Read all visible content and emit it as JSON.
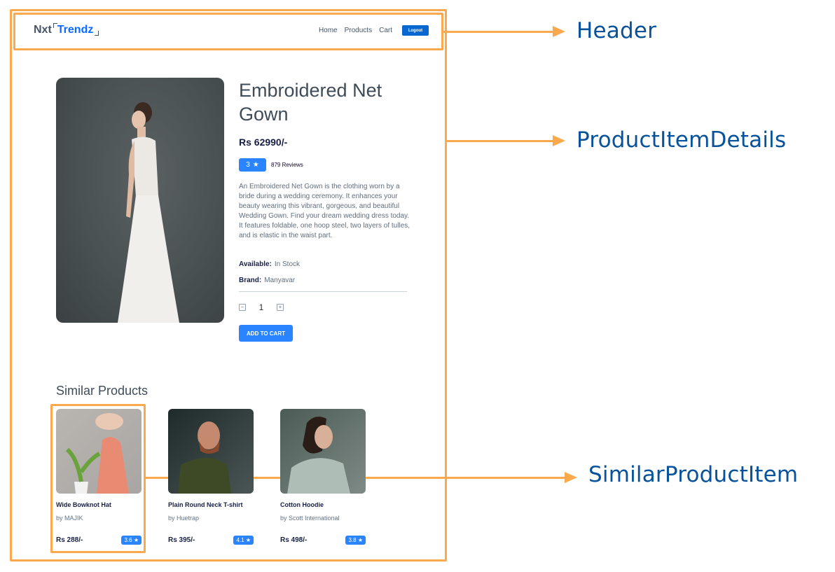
{
  "annotations": {
    "header": "Header",
    "product_item_details": "ProductItemDetails",
    "similar_product_item": "SimilarProductItem",
    "frame_color": "#fba94c",
    "label_color": "#07529a"
  },
  "header": {
    "logo_prefix": "Nxt",
    "logo_brand": "Trendz",
    "nav": [
      "Home",
      "Products",
      "Cart"
    ],
    "logout_label": "Logout",
    "accent_color": "#0967d2"
  },
  "product": {
    "title": "Embroidered Net Gown",
    "price": "Rs 62990/-",
    "rating": "3",
    "rating_icon": "star-icon",
    "reviews": "879 Reviews",
    "description": "An Embroidered Net Gown is the clothing worn by a bride during a wedding ceremony. It enhances your beauty wearing this vibrant, gorgeous, and beautiful Wedding Gown. Find your dream wedding dress today. It features foldable, one hoop steel, two layers of tulles, and is elastic in the waist part.",
    "availability_label": "Available:",
    "availability": "In Stock",
    "brand_label": "Brand:",
    "brand": "Manyavar",
    "quantity": "1",
    "minus_icon": "minus-square-icon",
    "plus_icon": "plus-square-icon",
    "add_to_cart_label": "ADD TO CART"
  },
  "similar": {
    "title": "Similar Products",
    "items": [
      {
        "name": "Wide Bowknot Hat",
        "brand": "by MAJIK",
        "price": "Rs 288/-",
        "rating": "3.6 ★"
      },
      {
        "name": "Plain Round Neck T-shirt",
        "brand": "by Huetrap",
        "price": "Rs 395/-",
        "rating": "4.1 ★"
      },
      {
        "name": "Cotton Hoodie",
        "brand": "by Scott International",
        "price": "Rs 498/-",
        "rating": "3.8 ★"
      }
    ]
  }
}
